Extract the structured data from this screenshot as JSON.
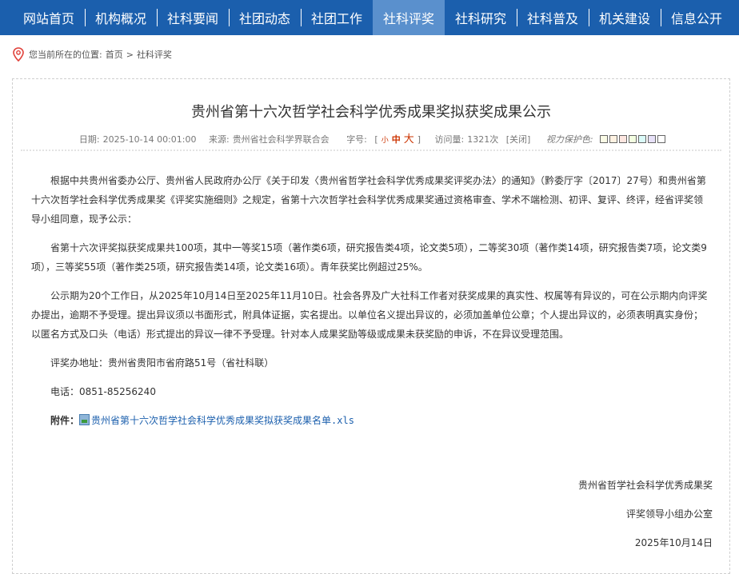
{
  "nav": {
    "items": [
      "网站首页",
      "机构概况",
      "社科要闻",
      "社团动态",
      "社团工作",
      "社科评奖",
      "社科研究",
      "社科普及",
      "机关建设",
      "信息公开"
    ],
    "active_index": 5
  },
  "breadcrumb": {
    "prefix": "您当前所在的位置:",
    "home": "首页",
    "separator": ">",
    "current": "社科评奖"
  },
  "article": {
    "title": "贵州省第十六次哲学社会科学优秀成果奖拟获奖成果公示",
    "date_label": "日期:",
    "date": "2025-10-14 00:01:00",
    "source_label": "来源:",
    "source": "贵州省社会科学界联合会",
    "fontsize_label": "字号:",
    "bracket_open": "[",
    "size_small": "小",
    "size_mid": "中",
    "size_big": "大",
    "bracket_close": "]",
    "views_label": "访问量:",
    "views": "1321次",
    "close_label": "[关闭]",
    "eye_label": "视力保护色:",
    "eye_colors": [
      "#fafbe6",
      "#fff2e2",
      "#fde6e0",
      "#f3ffe1",
      "#dafaf8",
      "#e7e1f8",
      "#ffffff"
    ],
    "paragraphs": [
      "根据中共贵州省委办公厅、贵州省人民政府办公厅《关于印发〈贵州省哲学社会科学优秀成果奖评奖办法〉的通知》（黔委厅字〔2017〕27号）和贵州省第十六次哲学社会科学优秀成果奖《评奖实施细则》之规定，省第十六次哲学社会科学优秀成果奖通过资格审查、学术不端检测、初评、复评、终评，经省评奖领导小组同意，现予公示：",
      "省第十六次评奖拟获奖成果共100项，其中一等奖15项（著作类6项，研究报告类4项，论文类5项），二等奖30项（著作类14项，研究报告类7项，论文类9项），三等奖55项（著作类25项，研究报告类14项，论文类16项）。青年获奖比例超过25%。",
      "公示期为20个工作日，从2025年10月14日至2025年11月10日。社会各界及广大社科工作者对获奖成果的真实性、权属等有异议的，可在公示期内向评奖办提出，逾期不予受理。提出异议须以书面形式，附具体证据，实名提出。以单位名义提出异议的，必须加盖单位公章；个人提出异议的，必须表明真实身份；以匿名方式及口头（电话）形式提出的异议一律不予受理。针对本人成果奖励等级或成果未获奖励的申诉，不在异议受理范围。"
    ],
    "address": "评奖办地址：贵州省贵阳市省府路51号（省社科联）",
    "phone": "电话：0851-85256240",
    "attachment_label": "附件：",
    "attachment_file": "贵州省第十六次哲学社会科学优秀成果奖拟获奖成果名单.xls",
    "signature_line1": "贵州省哲学社会科学优秀成果奖",
    "signature_line2": "评奖领导小组办公室",
    "signature_date": "2025年10月14日"
  },
  "colors": {
    "nav_bg": "#1b5fad",
    "nav_active": "#5a90cd",
    "fontsize_accent": "#cc3300"
  }
}
